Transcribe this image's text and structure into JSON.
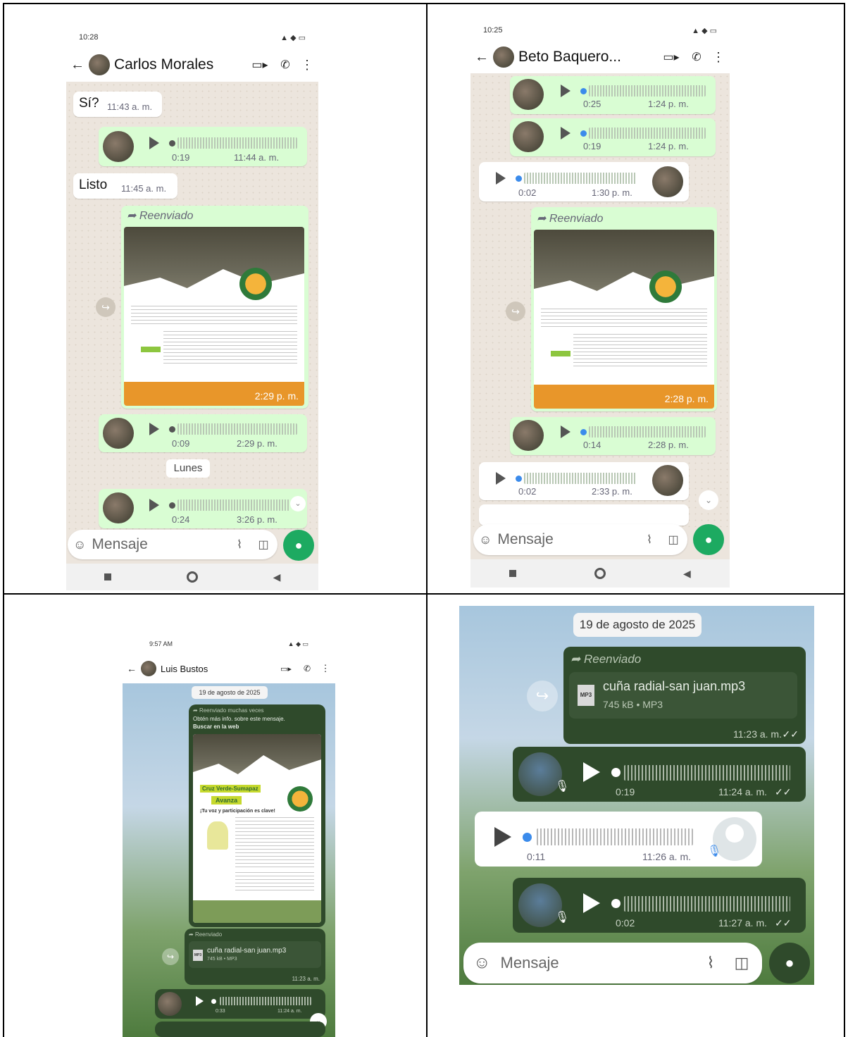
{
  "p1": {
    "status_time": "10:28",
    "contact": "Carlos Morales",
    "msg_si": "Sí?",
    "msg_si_time": "11:43 a. m.",
    "audio1": {
      "dur": "0:19",
      "time": "11:44 a. m."
    },
    "msg_listo": "Listo",
    "msg_listo_time": "11:45 a. m.",
    "forwarded": "Reenviado",
    "poster_time": "2:29 p. m.",
    "audio2": {
      "dur": "0:09",
      "time": "2:29 p. m."
    },
    "day": "Lunes",
    "audio3": {
      "dur": "0:24",
      "time": "3:26 p. m."
    },
    "placeholder": "Mensaje"
  },
  "p2": {
    "status_time": "10:25",
    "contact": "Beto Baquero...",
    "audio1": {
      "dur": "0:25",
      "time": "1:24 p. m."
    },
    "audio2": {
      "dur": "0:19",
      "time": "1:24 p. m."
    },
    "audio3": {
      "dur": "0:02",
      "time": "1:30 p. m."
    },
    "forwarded": "Reenviado",
    "poster_time": "2:28 p. m.",
    "audio4": {
      "dur": "0:14",
      "time": "2:28 p. m."
    },
    "audio5": {
      "dur": "0:02",
      "time": "2:33 p. m."
    },
    "placeholder": "Mensaje"
  },
  "p3": {
    "status_time": "9:57 AM",
    "contact": "Luis Bustos",
    "date": "19 de agosto de 2025",
    "fwd_many": "Reenviado muchas veces",
    "more_info": "Obtén más info. sobre este mensaje.",
    "search_web": "Buscar en la web",
    "poster_title": "Cruz Verde-Sumapaz",
    "poster_sub": "Avanza",
    "poster_slogan": "¡Tu voz y participación es clave!",
    "forwarded": "Reenviado",
    "file_name": "cuña radial-san juan.mp3",
    "file_meta": "745 kB • MP3",
    "file_time": "11:23 a. m.",
    "audio1": {
      "dur": "0:33",
      "time": "11:24 a. m."
    }
  },
  "p4": {
    "date": "19 de agosto de 2025",
    "forwarded": "Reenviado",
    "file_name": "cuña radial-san juan.mp3",
    "file_type": "MP3",
    "file_meta": "745 kB • MP3",
    "file_time": "11:23 a. m.",
    "audio1": {
      "dur": "0:19",
      "time": "11:24 a. m."
    },
    "audio2": {
      "dur": "0:11",
      "time": "11:26 a. m."
    },
    "audio3": {
      "dur": "0:02",
      "time": "11:27 a. m."
    },
    "placeholder": "Mensaje"
  },
  "colors": {
    "outgoing": "#d9fdd3",
    "accent": "#1daa61",
    "dark_bubble": "#2f4a2b"
  }
}
